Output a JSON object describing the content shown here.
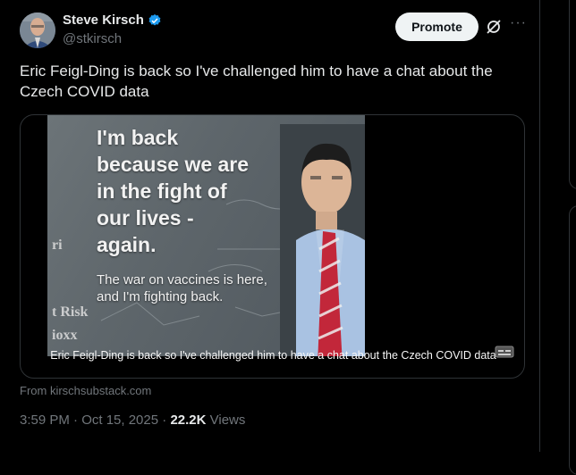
{
  "author": {
    "display_name": "Steve Kirsch",
    "handle": "@stkirsch"
  },
  "actions": {
    "promote_label": "Promote",
    "more_label": "···"
  },
  "tweet": {
    "text": "Eric Feigl-Ding is back so I've challenged him to have a chat about the Czech COVID data"
  },
  "media": {
    "overlay_title": "I'm back\nbecause we are\nin the fight of\nour lives -\nagain.",
    "overlay_sub": "The war on vaccines is here,\nand I'm fighting back.",
    "bg_scrawl_1": "ri",
    "bg_scrawl_2": "t Risk",
    "bg_scrawl_3": "ioxx",
    "caption": "Eric Feigl-Ding is back so I've challenged him to have a chat about the Czech COVID data"
  },
  "card_source": "From kirschsubstack.com",
  "meta": {
    "time": "3:59 PM · Oct 15, 2025",
    "separator": " · ",
    "views_count": "22.2K",
    "views_label": " Views"
  },
  "colors": {
    "background": "#000000",
    "text_primary": "#e7e9ea",
    "text_secondary": "#71767b",
    "verified_blue": "#1d9bf0",
    "tie_red": "#c2273a"
  }
}
